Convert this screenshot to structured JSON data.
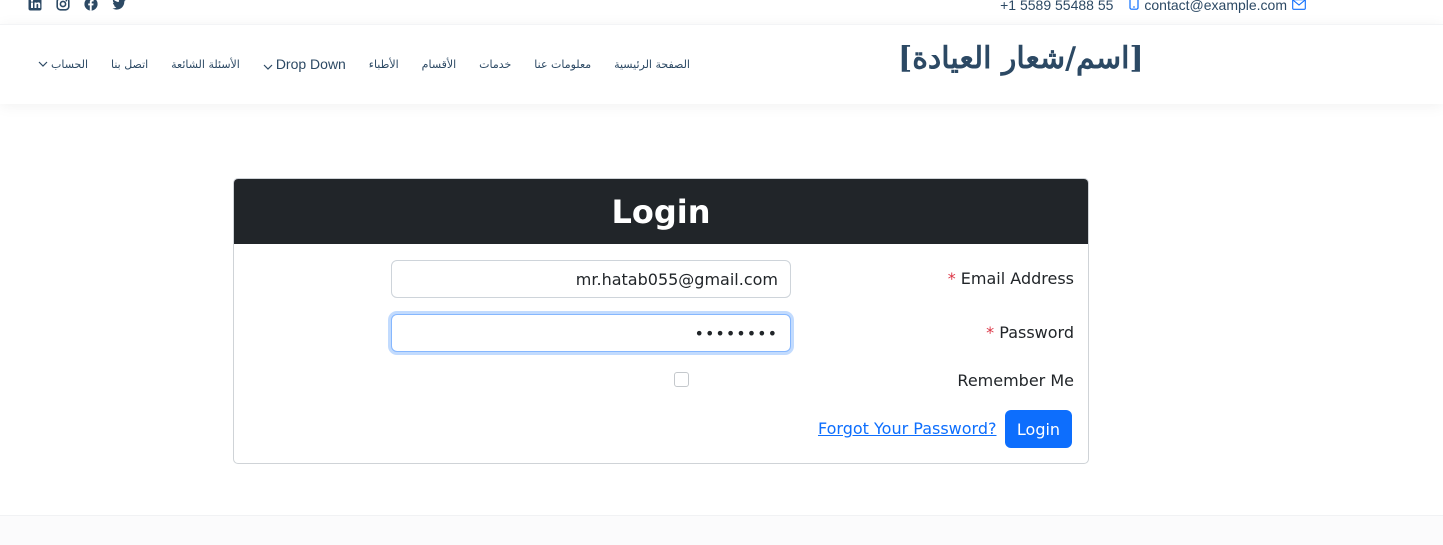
{
  "topbar": {
    "email": "contact@example.com",
    "phone": "+1 5589 55488 55",
    "social_icons": [
      "twitter-icon",
      "facebook-icon",
      "instagram-icon",
      "linkedin-icon"
    ]
  },
  "header": {
    "logo": "[اسم/شعار العيادة]",
    "nav": [
      {
        "label": "الصفحة الرئيسية",
        "dropdown": false
      },
      {
        "label": "معلومات عنا",
        "dropdown": false
      },
      {
        "label": "خدمات",
        "dropdown": false
      },
      {
        "label": "الأقسام",
        "dropdown": false
      },
      {
        "label": "الأطباء",
        "dropdown": false
      },
      {
        "label": "Drop Down",
        "dropdown": true
      },
      {
        "label": "الأسئلة الشائعة",
        "dropdown": false
      },
      {
        "label": "اتصل بنا",
        "dropdown": false
      },
      {
        "label": "الحساب",
        "dropdown": true
      }
    ]
  },
  "login": {
    "title": "Login",
    "email_label": "Email Address",
    "email_value": "mr.hatab055@gmail.com",
    "password_label": "Password",
    "password_value": "••••••••",
    "required_mark": "*",
    "remember_label": "Remember Me",
    "submit_label": "Login",
    "forgot_label": "Forgot Your Password?"
  },
  "colors": {
    "brand": "#2c4964",
    "primary": "#0d6efd",
    "header_dark": "#212529",
    "required": "#dc3545"
  }
}
